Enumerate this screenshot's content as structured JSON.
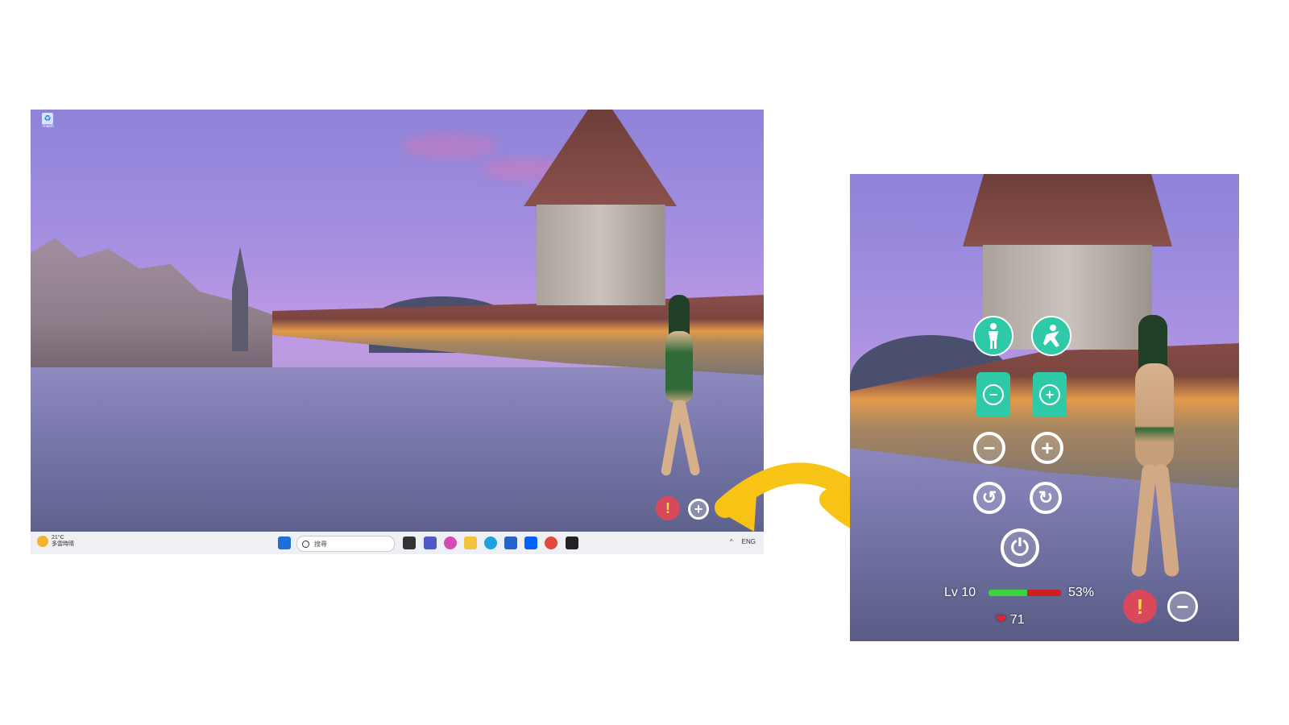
{
  "desktop": {
    "recycle_label": "Trash",
    "weather": {
      "temp": "21°C",
      "desc": "多雲時晴"
    },
    "search_placeholder": "搜尋",
    "tray_lang": "ENG",
    "tray_caret": "^"
  },
  "pet_small": {
    "warn_symbol": "!",
    "expand_symbol": "+"
  },
  "pet_menu": {
    "icons": [
      "body-pose-icon",
      "dance-icon",
      "shirt-minus-icon",
      "shirt-plus-icon",
      "zoom-out-icon",
      "zoom-in-icon",
      "rotate-left-icon",
      "rotate-right-icon",
      "power-icon"
    ],
    "level_label": "Lv 10",
    "progress_fraction": 0.53,
    "progress_text": "53%",
    "hearts": "71",
    "warn_symbol": "!",
    "collapse_symbol": "−"
  },
  "colors": {
    "accent": "#2ec9a7",
    "warning": "#d9485b",
    "arrow": "#f7c314",
    "bar_good": "#3bd63b",
    "bar_bad": "#cc2020"
  }
}
